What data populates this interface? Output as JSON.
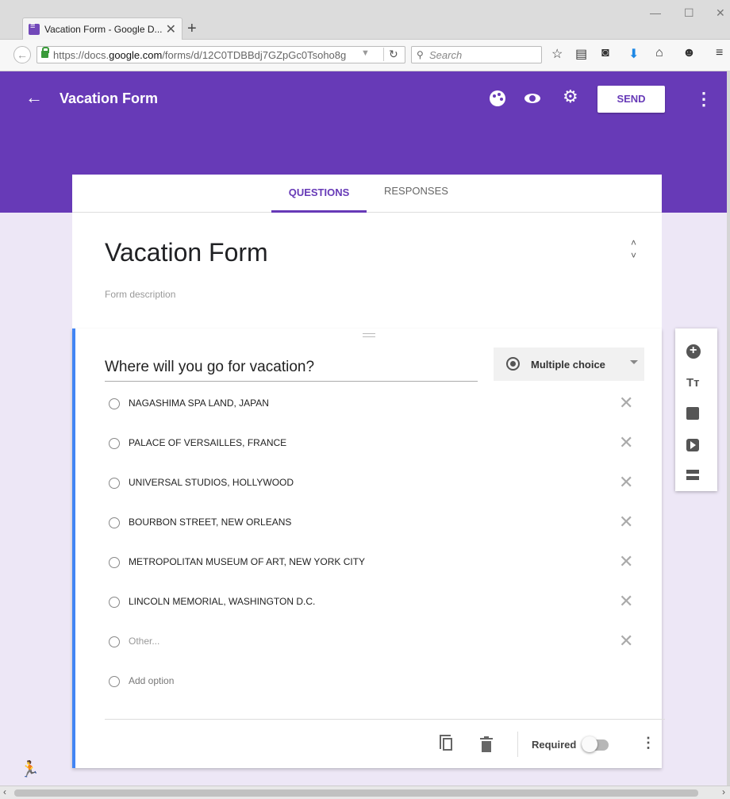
{
  "browser": {
    "tab_title": "Vacation Form - Google D...",
    "tab_close": "✕",
    "new_tab": "+",
    "url_prefix": "https://docs.",
    "url_domain": "google.com",
    "url_suffix": "/forms/d/12C0TDBBdj7GZpGc0Tsoho8g",
    "search_placeholder": "Search"
  },
  "appbar": {
    "title": "Vacation Form",
    "send_label": "SEND",
    "accent_color": "#673ab7"
  },
  "tabs": [
    {
      "label": "QUESTIONS",
      "active": true
    },
    {
      "label": "RESPONSES",
      "active": false
    }
  ],
  "form": {
    "title": "Vacation Form",
    "description_placeholder": "Form description"
  },
  "question": {
    "title": "Where will you go for vacation?",
    "type": "Multiple choice",
    "options": [
      "NAGASHIMA SPA LAND, JAPAN",
      "PALACE OF VERSAILLES, FRANCE",
      "UNIVERSAL STUDIOS, HOLLYWOOD",
      "BOURBON STREET, NEW ORLEANS",
      "METROPOLITAN MUSEUM OF ART, NEW YORK CITY",
      "LINCOLN MEMORIAL, WASHINGTON D.C."
    ],
    "other_label": "Other...",
    "add_option_label": "Add option",
    "required_label": "Required",
    "required": false
  },
  "toolbar": {
    "text_icon_label": "Tт"
  }
}
